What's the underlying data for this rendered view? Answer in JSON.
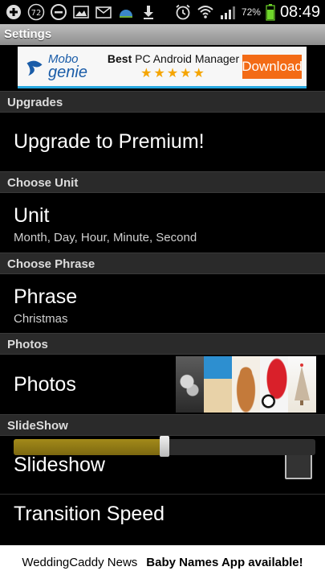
{
  "status_bar": {
    "left_icons": [
      "plus-icon",
      "notification-count-icon",
      "minus-circle-icon",
      "image-icon",
      "gmail-icon",
      "weather-icon",
      "download-icon"
    ],
    "notification_count": "72",
    "right_icons": [
      "alarm-icon",
      "wifi-icon",
      "signal-icon",
      "battery-icon"
    ],
    "battery_percent": "72%",
    "time": "08:49"
  },
  "title_bar": {
    "title": "Settings"
  },
  "ad_banner": {
    "logo_line1": "Mobo",
    "logo_line2": "genie",
    "headline_bold": "Best",
    "headline_rest": " PC Android Manager",
    "stars": "★★★★★",
    "button_label": "Download"
  },
  "sections": {
    "upgrades": {
      "header": "Upgrades",
      "title": "Upgrade to Premium!"
    },
    "unit": {
      "header": "Choose Unit",
      "title": "Unit",
      "summary": "Month, Day, Hour, Minute, Second"
    },
    "phrase": {
      "header": "Choose Phrase",
      "title": "Phrase",
      "summary": "Christmas"
    },
    "photos": {
      "header": "Photos",
      "title": "Photos"
    },
    "slideshow": {
      "header": "SlideShow",
      "title": "Slideshow",
      "checked": false
    },
    "transition": {
      "title": "Transition Speed",
      "slider_fraction": 0.5
    }
  },
  "bottom_bar": {
    "left_text": "WeddingCaddy News",
    "right_text": "Baby Names App available!"
  },
  "colors": {
    "header_bg": "#2a2a2a",
    "ad_button": "#f36b16",
    "slider_fill": "#a38a1a"
  }
}
